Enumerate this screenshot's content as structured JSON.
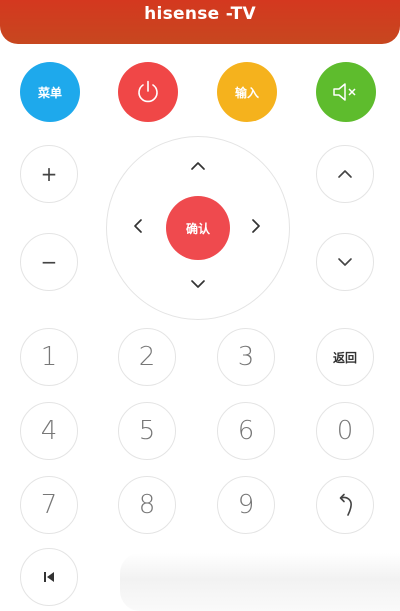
{
  "header": {
    "title": "hisense -TV"
  },
  "top_buttons": {
    "menu": {
      "label": "菜单",
      "color": "#1ea9ec"
    },
    "power": {
      "icon": "power-icon",
      "color": "#f04747"
    },
    "input": {
      "label": "输入",
      "color": "#f5b21d"
    },
    "mute": {
      "icon": "mute-icon",
      "color": "#5ebc2d"
    }
  },
  "side_buttons": {
    "volume_up": "+",
    "volume_down": "−",
    "channel_up": "channel-up-chevron-icon",
    "channel_down": "channel-down-chevron-icon"
  },
  "dpad": {
    "ok_label": "确认",
    "ok_color": "#ef4a4e",
    "arrows": [
      "up-chevron-icon",
      "left-chevron-icon",
      "right-chevron-icon",
      "down-chevron-icon"
    ]
  },
  "numpad": {
    "digits": [
      "1",
      "2",
      "3",
      "4",
      "5",
      "6",
      "7",
      "8",
      "9",
      "0"
    ],
    "back_label": "返回",
    "return_icon": "return-arrow-icon",
    "previous_icon": "skip-previous-icon"
  }
}
